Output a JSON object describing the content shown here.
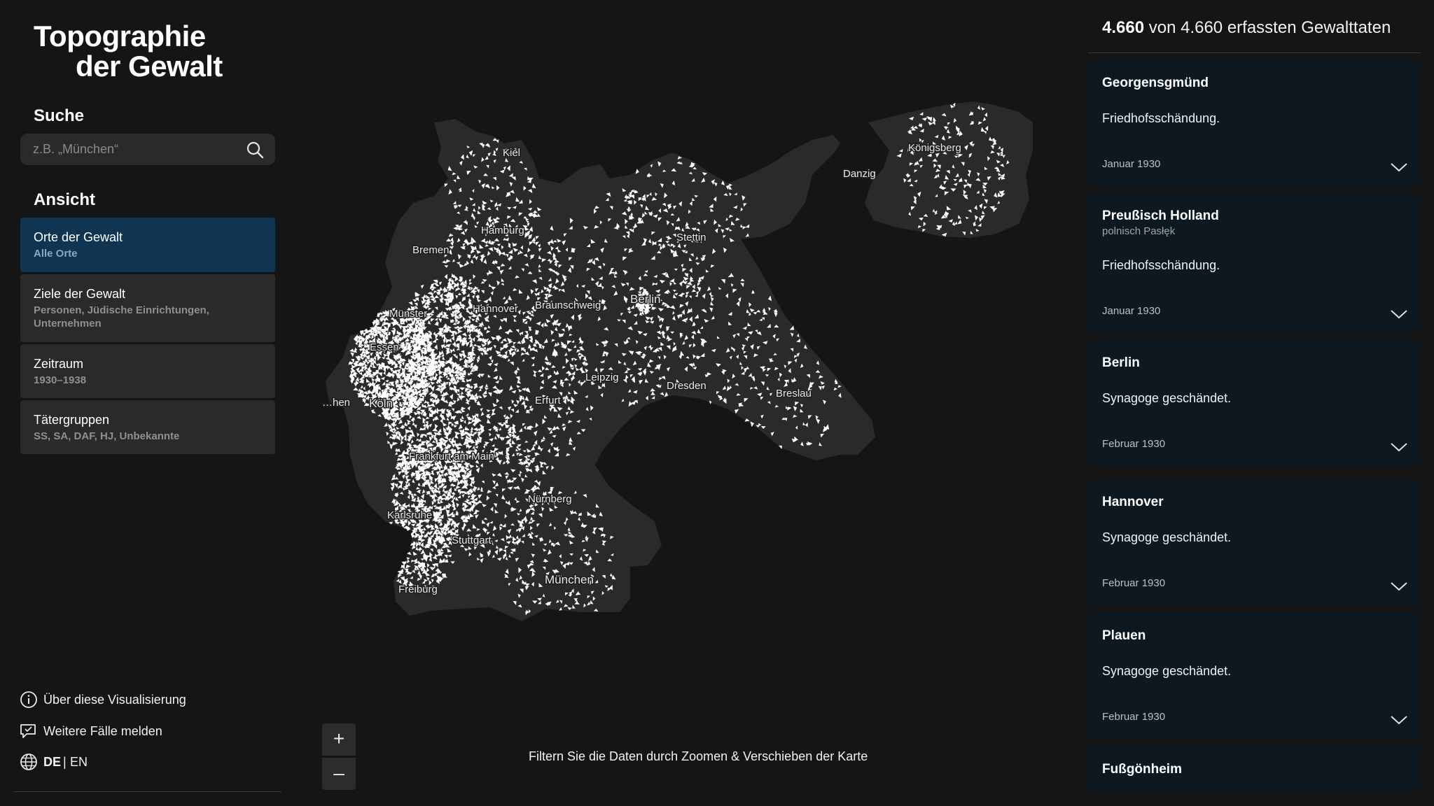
{
  "sidebar": {
    "title_line1": "Topographie",
    "title_line2": "der Gewalt",
    "search": {
      "heading": "Suche",
      "placeholder": "z.B. „München“"
    },
    "view": {
      "heading": "Ansicht",
      "items": [
        {
          "label": "Orte der Gewalt",
          "sub": "Alle Orte",
          "active": true
        },
        {
          "label": "Ziele der Gewalt",
          "sub": "Personen, Jüdische Einrichtungen, Unternehmen",
          "active": false
        },
        {
          "label": "Zeitraum",
          "sub": "1930–1938",
          "active": false
        },
        {
          "label": "Tätergruppen",
          "sub": "SS, SA, DAF, HJ, Unbekannte",
          "active": false
        }
      ]
    },
    "footer": {
      "about": "Über diese Visualisierung",
      "report": "Weitere Fälle melden",
      "lang_de": "DE",
      "lang_sep": "|",
      "lang_en": "EN"
    }
  },
  "map": {
    "zoom_in": "+",
    "zoom_out": "–",
    "hint": "Filtern Sie die Daten durch Zoomen & Verschieben der Karte",
    "cities": [
      "Kiel",
      "Hamburg",
      "Bremen",
      "Stettin",
      "Danzig",
      "Königsberg",
      "Berlin",
      "Hannover",
      "Braunschweig",
      "Münster",
      "Essen",
      "Köln",
      "Leipzig",
      "Dresden",
      "Breslau",
      "Erfurt",
      "Frankfurt am Main",
      "Nürnberg",
      "Karlsruhe",
      "Stuttgart",
      "Freiburg",
      "München",
      "…hen"
    ]
  },
  "results": {
    "shown": "4.660",
    "rest": "von 4.660 erfassten Gewalttaten",
    "cards": [
      {
        "place": "Georgensgmünd",
        "alt": "",
        "desc": "Friedhofsschändung.",
        "date": "Januar 1930"
      },
      {
        "place": "Preußisch Holland",
        "alt": "polnisch Pasłęk",
        "desc": "Friedhofsschändung.",
        "date": "Januar 1930"
      },
      {
        "place": "Berlin",
        "alt": "",
        "desc": "Synagoge geschändet.",
        "date": "Februar 1930"
      },
      {
        "place": "Hannover",
        "alt": "",
        "desc": "Synagoge geschändet.",
        "date": "Februar 1930"
      },
      {
        "place": "Plauen",
        "alt": "",
        "desc": "Synagoge geschändet.",
        "date": "Februar 1930"
      },
      {
        "place": "Fußgönheim",
        "alt": "",
        "desc": "",
        "date": ""
      }
    ]
  },
  "colors": {
    "background": "#151515",
    "map_land": "#2a2a2a",
    "marker": "#ffffff",
    "active_item": "#0f3552",
    "card": "#0d1820"
  }
}
